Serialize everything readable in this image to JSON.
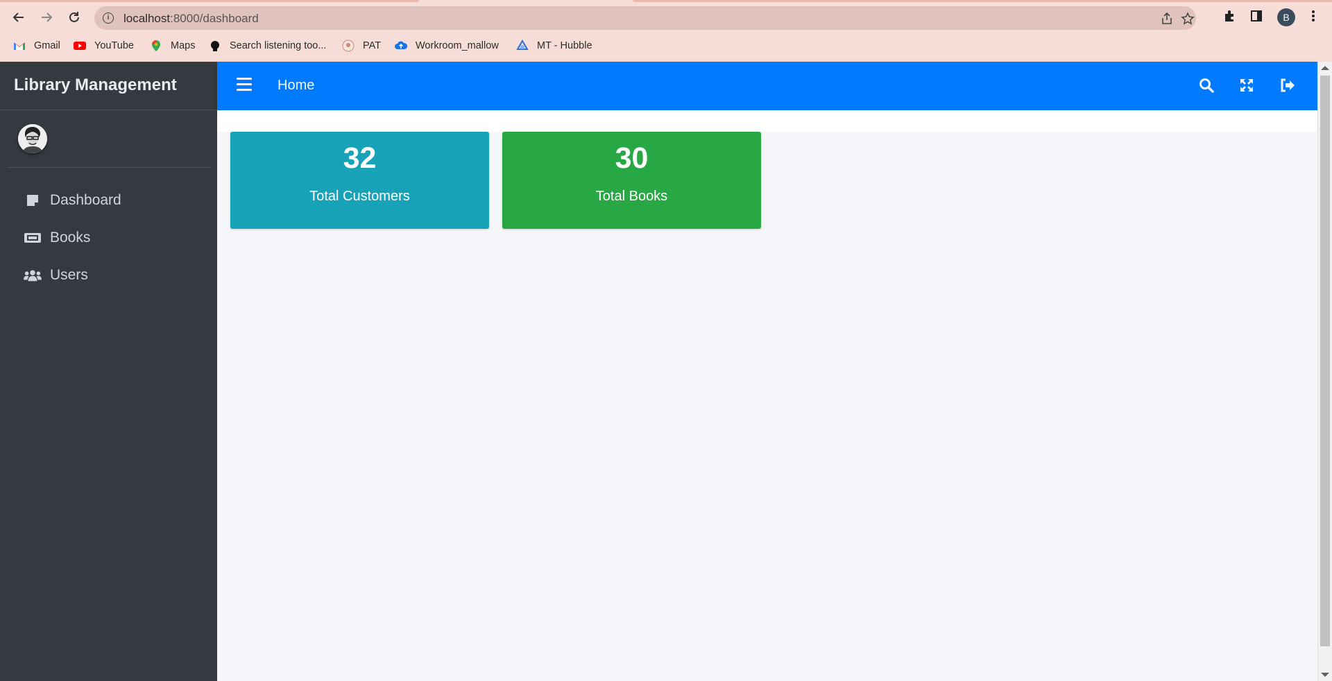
{
  "browser": {
    "url_host": "localhost",
    "url_path": ":8000/dashboard",
    "profile_initial": "B",
    "bookmarks": [
      {
        "label": "Gmail",
        "icon": "gmail-icon",
        "color": "#ea4335"
      },
      {
        "label": "YouTube",
        "icon": "youtube-icon",
        "color": "#ff0000"
      },
      {
        "label": "Maps",
        "icon": "maps-icon",
        "color": "#34a853"
      },
      {
        "label": "Search listening too...",
        "icon": "search-listening-icon",
        "color": "#111111"
      },
      {
        "label": "PAT",
        "icon": "pat-icon",
        "color": "#c98a7a"
      },
      {
        "label": "Workroom_mallow",
        "icon": "workroom-icon",
        "color": "#1a73e8"
      },
      {
        "label": "MT - Hubble",
        "icon": "hubble-icon",
        "color": "#2a6fd6"
      }
    ]
  },
  "sidebar": {
    "brand": "Library Management",
    "items": [
      {
        "label": "Dashboard",
        "icon": "dashboard-icon"
      },
      {
        "label": "Books",
        "icon": "books-icon"
      },
      {
        "label": "Users",
        "icon": "users-icon"
      }
    ]
  },
  "navbar": {
    "home_label": "Home",
    "accent": "#007bff"
  },
  "stats": [
    {
      "value": "32",
      "label": "Total Customers",
      "color": "#17a2b8"
    },
    {
      "value": "30",
      "label": "Total Books",
      "color": "#28a745"
    }
  ]
}
